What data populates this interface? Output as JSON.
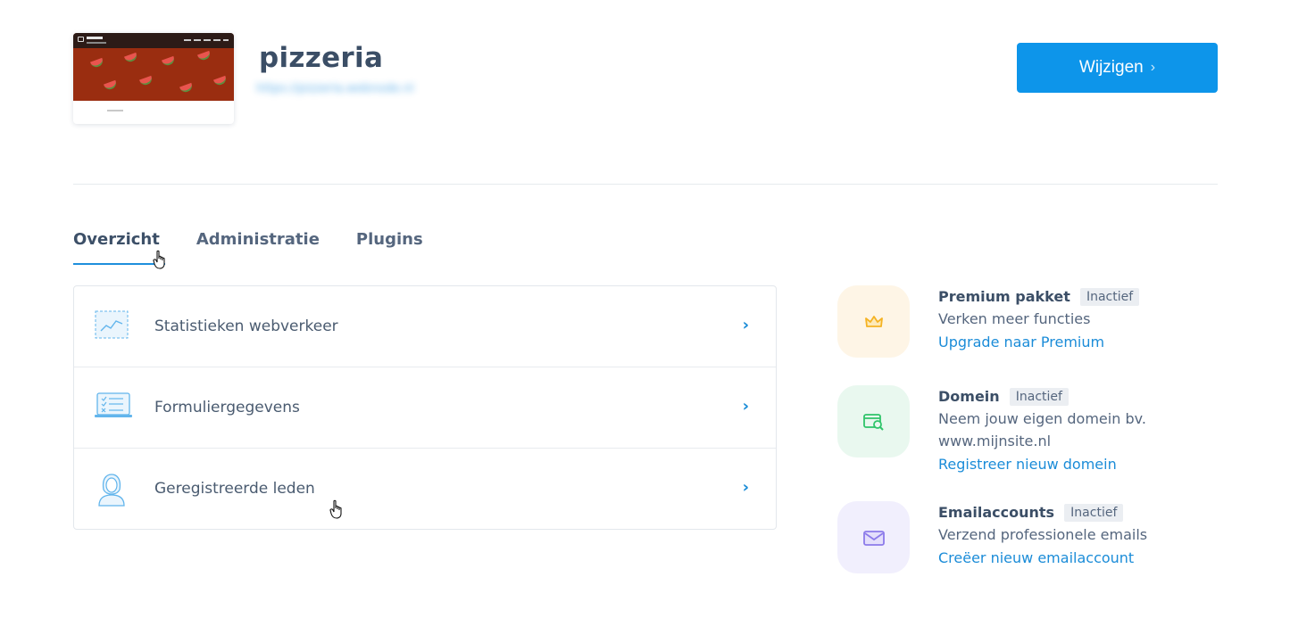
{
  "site": {
    "title": "pizzeria",
    "url": "https://pizzeria.webnode.nl"
  },
  "header": {
    "edit_button_label": "Wijzigen",
    "edit_button_chevron": "›"
  },
  "tabs": [
    {
      "label": "Overzicht",
      "active": true
    },
    {
      "label": "Administratie",
      "active": false
    },
    {
      "label": "Plugins",
      "active": false
    }
  ],
  "overview_list": [
    {
      "label": "Statistieken webverkeer",
      "icon": "traffic-chart-icon",
      "chevron": "›"
    },
    {
      "label": "Formuliergegevens",
      "icon": "form-data-icon",
      "chevron": "›"
    },
    {
      "label": "Geregistreerde leden",
      "icon": "member-icon",
      "chevron": "›"
    }
  ],
  "features": [
    {
      "title": "Premium pakket",
      "badge": "Inactief",
      "description": "Verken meer functies",
      "link": "Upgrade naar Premium",
      "icon": "crown-icon",
      "color": "#f5b324",
      "bg": "#fef5e6"
    },
    {
      "title": "Domein",
      "badge": "Inactief",
      "description": "Neem jouw eigen domein bv. www.mijnsite.nl",
      "link": "Registreer nieuw domein",
      "icon": "domain-search-icon",
      "color": "#2fc46a",
      "bg": "#e9f8ef"
    },
    {
      "title": "Emailaccounts",
      "badge": "Inactief",
      "description": "Verzend professionele emails",
      "link": "Creëer nieuw emailaccount",
      "icon": "envelope-icon",
      "color": "#8c7bea",
      "bg": "#f1effd"
    }
  ],
  "colors": {
    "primary": "#0d95ea",
    "link": "#1b8cd8",
    "text": "#3b4e66"
  }
}
